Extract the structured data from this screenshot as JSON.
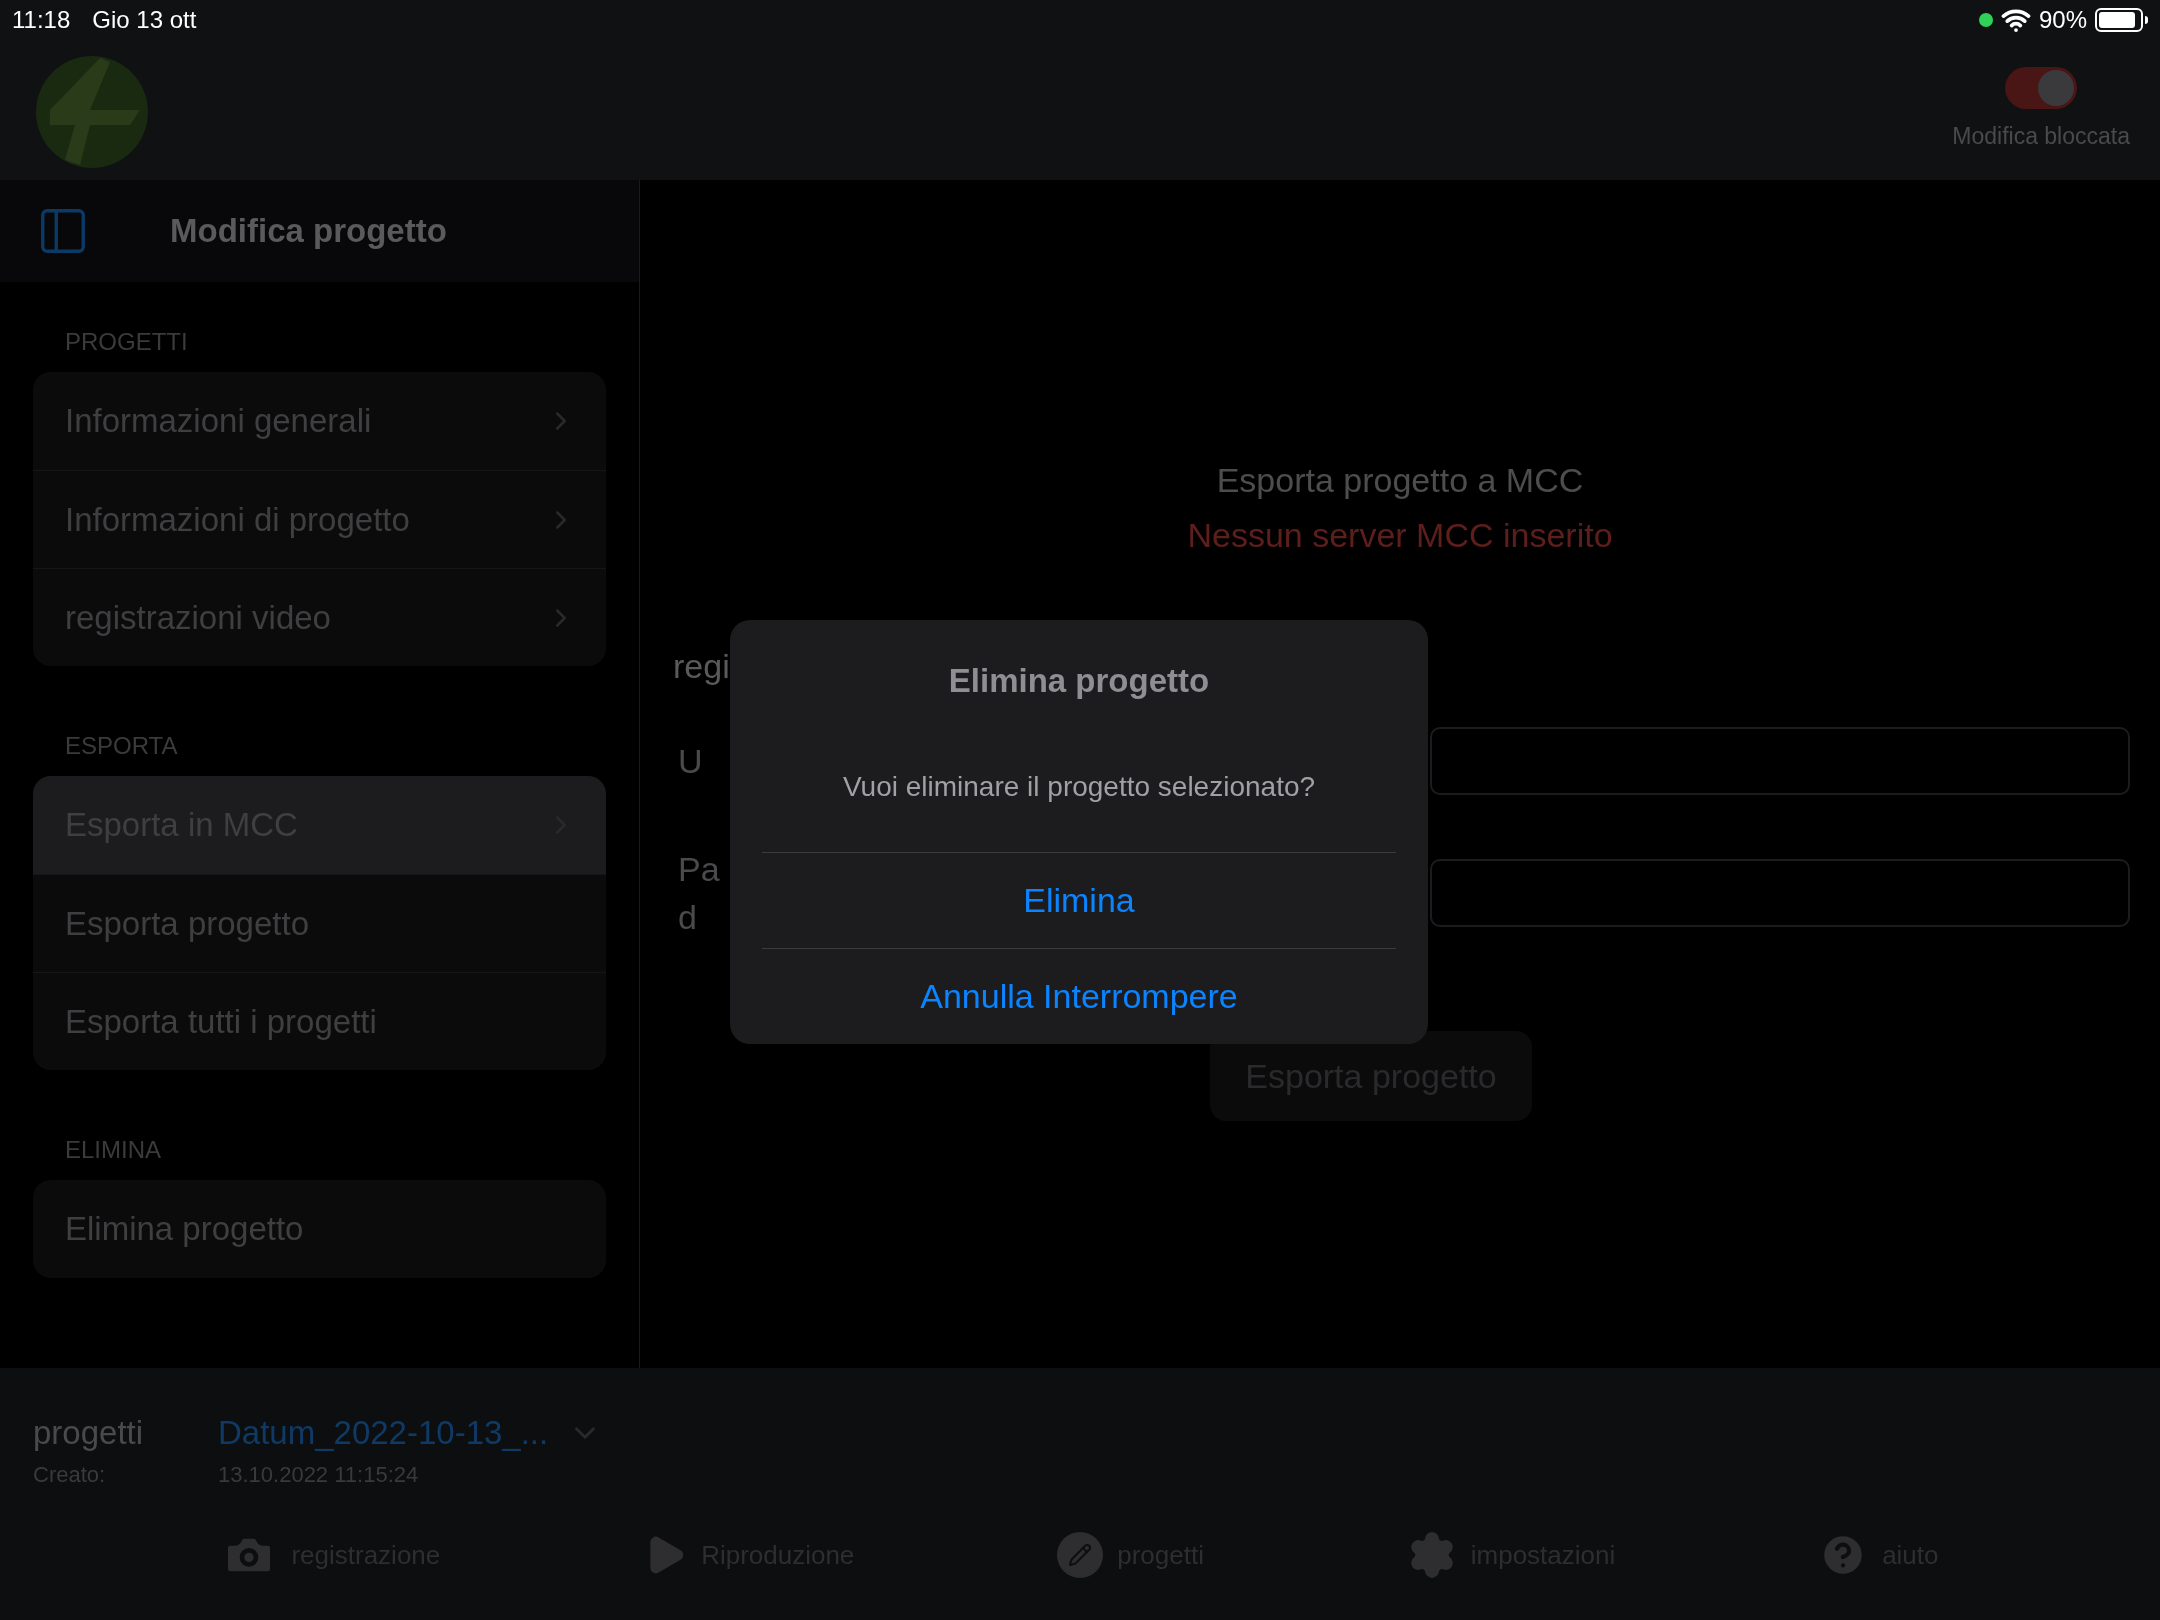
{
  "status_bar": {
    "time": "11:18",
    "date": "Gio 13 ott",
    "battery": "90%"
  },
  "header": {
    "lock_toggle": {
      "on": true,
      "label": "Modifica bloccata"
    }
  },
  "sidebar": {
    "title": "Modifica progetto",
    "sections": [
      {
        "heading": "PROGETTI",
        "items": [
          {
            "label": "Informazioni generali",
            "chevron": true,
            "selected": false
          },
          {
            "label": "Informazioni di progetto",
            "chevron": true,
            "selected": false
          },
          {
            "label": "registrazioni video",
            "chevron": true,
            "selected": false
          }
        ]
      },
      {
        "heading": "ESPORTA",
        "items": [
          {
            "label": "Esporta in MCC",
            "chevron": true,
            "selected": true
          },
          {
            "label": "Esporta progetto",
            "chevron": false,
            "selected": false
          },
          {
            "label": "Esporta tutti i progetti",
            "chevron": false,
            "selected": false
          }
        ]
      },
      {
        "heading": "ELIMINA",
        "items": [
          {
            "label": "Elimina progetto",
            "chevron": false,
            "selected": false
          }
        ]
      }
    ]
  },
  "main": {
    "title": "Esporta progetto a MCC",
    "error": "Nessun server MCC inserito",
    "label_fragment": "regi",
    "fields": [
      {
        "label_lines": [
          "U"
        ]
      },
      {
        "label_lines": [
          "Pa",
          "d"
        ]
      }
    ],
    "export_button": "Esporta progetto"
  },
  "dialog": {
    "title": "Elimina progetto",
    "message": "Vuoi eliminare il progetto selezionato?",
    "actions": [
      "Elimina",
      "Annulla Interrompere"
    ]
  },
  "project_bar": {
    "label": "progetti",
    "project": "Datum_2022-10-13_...",
    "created_label": "Creato:",
    "created": "13.10.2022 11:15:24"
  },
  "tab_bar": [
    {
      "label": "registrazione",
      "kind": "camera"
    },
    {
      "label": "Riproduzione",
      "kind": "play"
    },
    {
      "label": "progetti",
      "kind": "pencil"
    },
    {
      "label": "impostazioni",
      "kind": "gear"
    },
    {
      "label": "aiuto",
      "kind": "help"
    }
  ]
}
